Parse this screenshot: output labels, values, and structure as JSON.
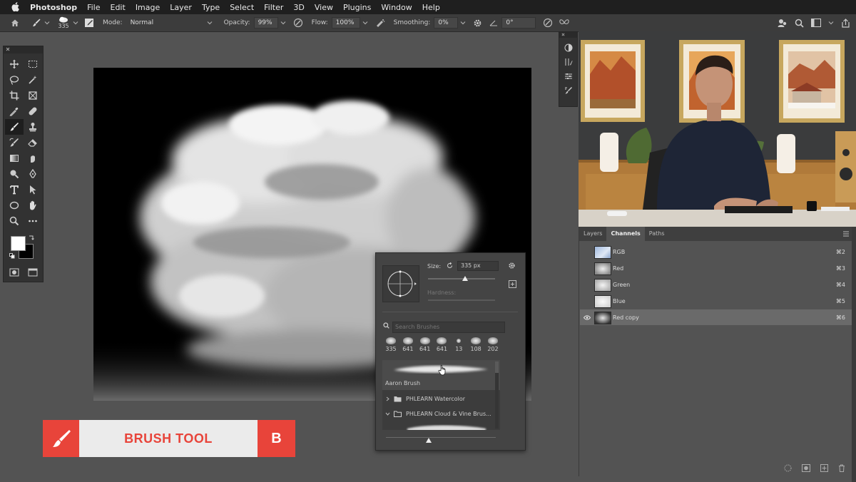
{
  "menubar": {
    "items": [
      "Photoshop",
      "File",
      "Edit",
      "Image",
      "Layer",
      "Type",
      "Select",
      "Filter",
      "3D",
      "View",
      "Plugins",
      "Window",
      "Help"
    ]
  },
  "options": {
    "brush_size": "335",
    "mode_label": "Mode:",
    "mode_value": "Normal",
    "opacity_label": "Opacity:",
    "opacity_value": "99%",
    "flow_label": "Flow:",
    "flow_value": "100%",
    "smoothing_label": "Smoothing:",
    "smoothing_value": "0%",
    "angle_value": "0°"
  },
  "brush_panel": {
    "size_label": "Size:",
    "size_value": "335 px",
    "size_fraction": 0.55,
    "hardness_label": "Hardness:",
    "search_placeholder": "Search Brushes",
    "presets": [
      "335",
      "641",
      "641",
      "641",
      "13",
      "108",
      "202"
    ],
    "selected_brush_name": "Aaron Brush",
    "folders": [
      "PHLEARN Watercolor",
      "PHLEARN Cloud & Vine Brus..."
    ]
  },
  "panel": {
    "tabs": [
      "Layers",
      "Channels",
      "Paths"
    ],
    "active_tab": "Channels",
    "channels": [
      {
        "name": "RGB",
        "key": "⌘2"
      },
      {
        "name": "Red",
        "key": "⌘3"
      },
      {
        "name": "Green",
        "key": "⌘4"
      },
      {
        "name": "Blue",
        "key": "⌘5"
      },
      {
        "name": "Red copy",
        "key": "⌘6"
      }
    ]
  },
  "lower_third": {
    "label": "BRUSH TOOL",
    "shortcut": "B"
  },
  "colors": {
    "accent_red": "#e8443a",
    "menubar_bg": "#1f1f1f",
    "workspace_bg": "#535353"
  }
}
